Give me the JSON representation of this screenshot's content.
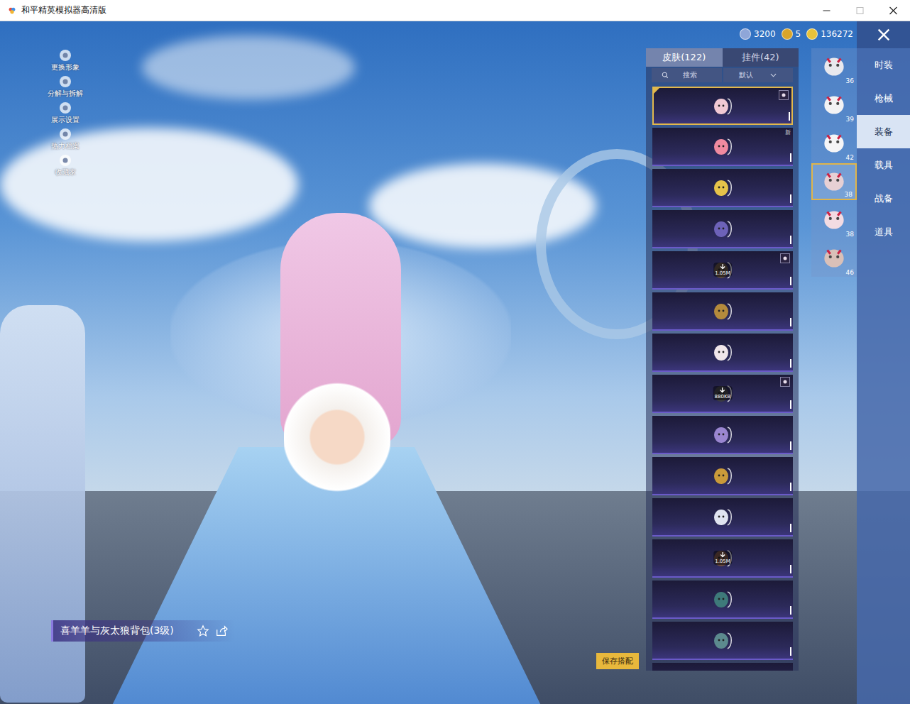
{
  "window": {
    "title": "和平精英模拟器高清版"
  },
  "left_menu": [
    {
      "label": "更换形象"
    },
    {
      "label": "分解与拆解"
    },
    {
      "label": "展示设置"
    },
    {
      "label": "热力档案"
    },
    {
      "label": "收藏家"
    }
  ],
  "currencies": [
    {
      "amount": "3200",
      "color": "#8fa6d8"
    },
    {
      "amount": "5",
      "color": "#d9a52a"
    },
    {
      "amount": "136272",
      "color": "#e8c23a"
    }
  ],
  "nav": [
    {
      "label": "时装",
      "selected": false
    },
    {
      "label": "枪械",
      "selected": false
    },
    {
      "label": "装备",
      "selected": true
    },
    {
      "label": "载具",
      "selected": false
    },
    {
      "label": "战备",
      "selected": false
    },
    {
      "label": "道具",
      "selected": false
    }
  ],
  "equip_slots": [
    {
      "level": "36",
      "selected": false,
      "color": "#e8e8ee"
    },
    {
      "level": "39",
      "selected": false,
      "color": "#f2f2f4"
    },
    {
      "level": "42",
      "selected": false,
      "color": "#f5f5f7"
    },
    {
      "level": "38",
      "selected": true,
      "color": "#e7d0d4"
    },
    {
      "level": "38",
      "selected": false,
      "color": "#f3dbe2"
    },
    {
      "level": "46",
      "selected": false,
      "color": "#d9c0b8"
    }
  ],
  "panel": {
    "tabs": [
      {
        "label": "皮肤(122)",
        "selected": true
      },
      {
        "label": "挂件(42)",
        "selected": false
      }
    ],
    "search": {
      "placeholder": "搜索"
    },
    "sort": {
      "label": "默认"
    }
  },
  "items": [
    {
      "selected": true,
      "tag": true,
      "badge": "",
      "size": "",
      "color": "#f1c9d4"
    },
    {
      "selected": false,
      "tag": false,
      "badge": "新",
      "size": "",
      "color": "#f08aa0"
    },
    {
      "selected": false,
      "tag": false,
      "badge": "",
      "size": "",
      "color": "#e6c34a"
    },
    {
      "selected": false,
      "tag": false,
      "badge": "",
      "size": "",
      "color": "#6d62b8"
    },
    {
      "selected": false,
      "tag": true,
      "badge": "",
      "size": "1.05M",
      "color": "#5a4a3e"
    },
    {
      "selected": false,
      "tag": false,
      "badge": "",
      "size": "",
      "color": "#b48a3c"
    },
    {
      "selected": false,
      "tag": false,
      "badge": "",
      "size": "",
      "color": "#f0e6ea"
    },
    {
      "selected": false,
      "tag": true,
      "badge": "",
      "size": "880KB",
      "color": "#3c3c44"
    },
    {
      "selected": false,
      "tag": false,
      "badge": "",
      "size": "",
      "color": "#9a86d0"
    },
    {
      "selected": false,
      "tag": false,
      "badge": "",
      "size": "",
      "color": "#c99a3a"
    },
    {
      "selected": false,
      "tag": false,
      "badge": "",
      "size": "",
      "color": "#e0e4f0"
    },
    {
      "selected": false,
      "tag": false,
      "badge": "",
      "size": "1.05M",
      "color": "#6a4a40"
    },
    {
      "selected": false,
      "tag": false,
      "badge": "",
      "size": "",
      "color": "#3e7a7a"
    },
    {
      "selected": false,
      "tag": false,
      "badge": "",
      "size": "",
      "color": "#5c8a8e"
    },
    {
      "selected": false,
      "tag": false,
      "badge": "",
      "size": "",
      "color": "#8890a8"
    }
  ],
  "selected_item": {
    "name": "喜羊羊与灰太狼背包(3级)"
  },
  "save_button": {
    "label": "保存搭配"
  }
}
